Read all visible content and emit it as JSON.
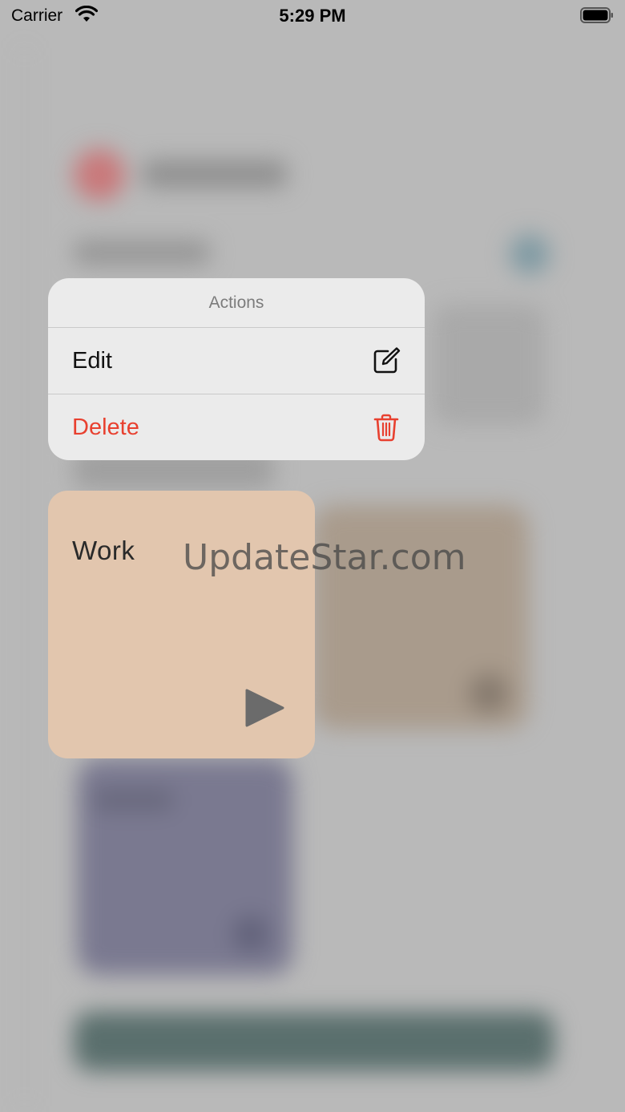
{
  "status_bar": {
    "carrier": "Carrier",
    "time": "5:29 PM"
  },
  "context_menu": {
    "title": "Actions",
    "items": [
      {
        "label": "Edit",
        "icon": "square-and-pencil-icon"
      },
      {
        "label": "Delete",
        "icon": "trash-icon",
        "color": "#e8402f"
      }
    ]
  },
  "card": {
    "title": "Work",
    "color": "#e2c6ae",
    "icon": "play-icon"
  },
  "watermark": "UpdateStar.com"
}
